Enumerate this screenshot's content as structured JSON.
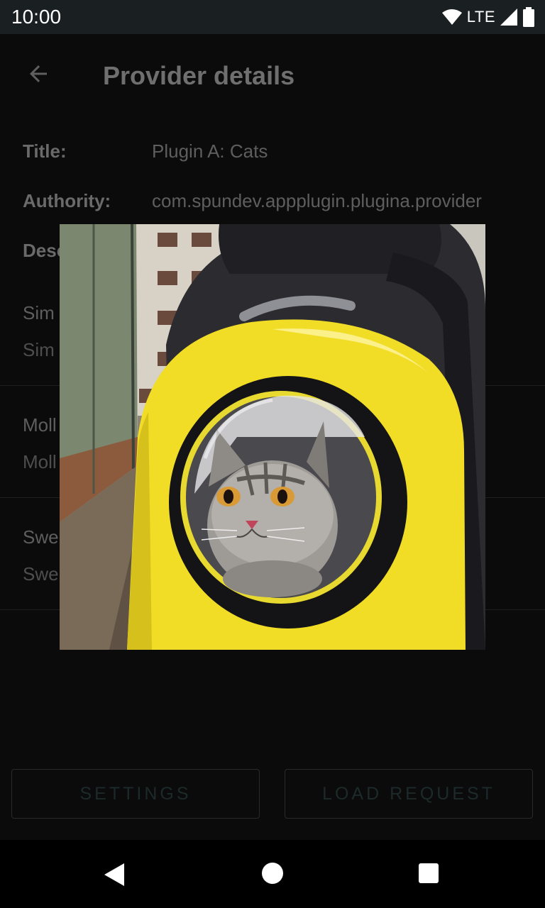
{
  "status_bar": {
    "time": "10:00",
    "network": "LTE",
    "icons": [
      "wifi-icon",
      "signal-icon",
      "battery-icon"
    ]
  },
  "app_bar": {
    "title": "Provider details",
    "back_icon": "arrow-back-icon"
  },
  "details": [
    {
      "label": "Title:",
      "value": "Plugin A: Cats"
    },
    {
      "label": "Authority:",
      "value": "com.spundev.appplugin.plugina.provider"
    },
    {
      "label": "Desc",
      "value": ""
    }
  ],
  "items": [
    {
      "title": "Sim",
      "subtitle": "Sim"
    },
    {
      "title": "Moll",
      "subtitle": "Moll"
    },
    {
      "title": "Swe",
      "subtitle": "Swe"
    }
  ],
  "buttons": {
    "settings": "SETTINGS",
    "load_request": "LOAD REQUEST"
  },
  "dialog": {
    "image": "cat-in-yellow-bubble-backpack-photo"
  },
  "nav_bar": {
    "icons": [
      "nav-back-icon",
      "nav-home-icon",
      "nav-recents-icon"
    ]
  },
  "colors": {
    "status_bar": "#1a1f21",
    "backpack_yellow": "#f1dd26",
    "dim_background": "#0b0b0c"
  }
}
